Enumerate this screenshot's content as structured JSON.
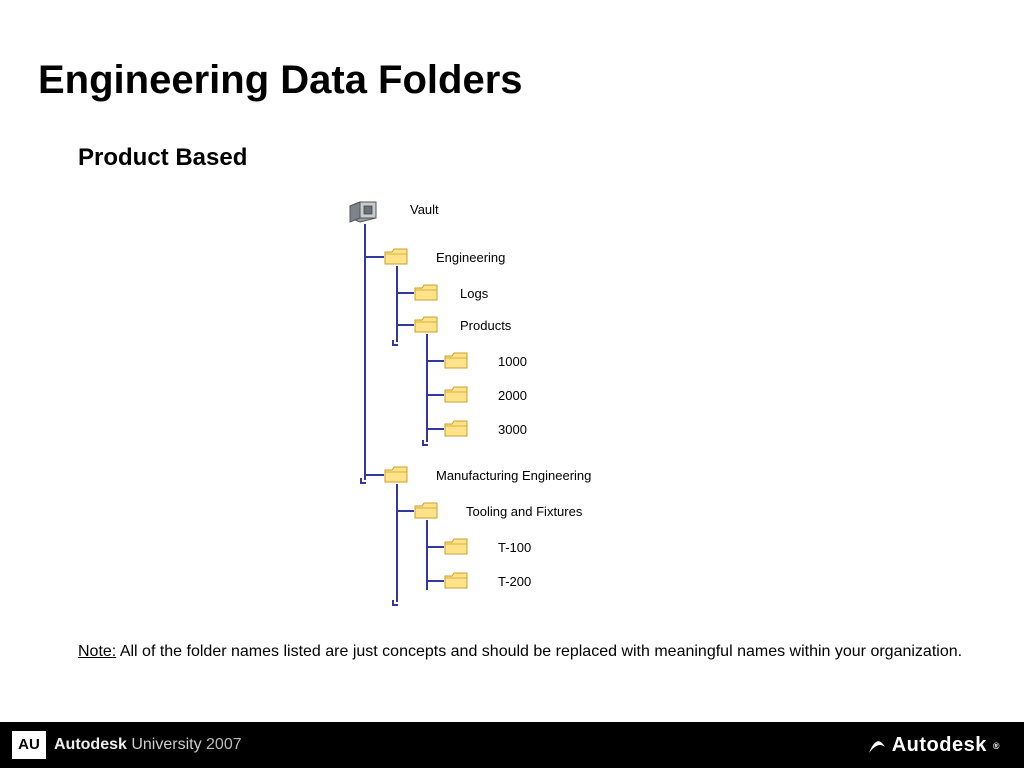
{
  "title": "Engineering Data Folders",
  "subtitle": "Product Based",
  "note_label": "Note:",
  "note_body": "  All of the folder names listed are just concepts and should be replaced with meaningful names within your organization.",
  "tree": {
    "root": "Vault",
    "engineering": "Engineering",
    "logs": "Logs",
    "products": "Products",
    "p1000": "1000",
    "p2000": "2000",
    "p3000": "3000",
    "manuf": "Manufacturing Engineering",
    "tooling": "Tooling and Fixtures",
    "t100": "T-100",
    "t200": "T-200"
  },
  "footer": {
    "badge": "AU",
    "brand": "Autodesk",
    "uni": " University ",
    "year": "2007",
    "logo": "Autodesk"
  }
}
